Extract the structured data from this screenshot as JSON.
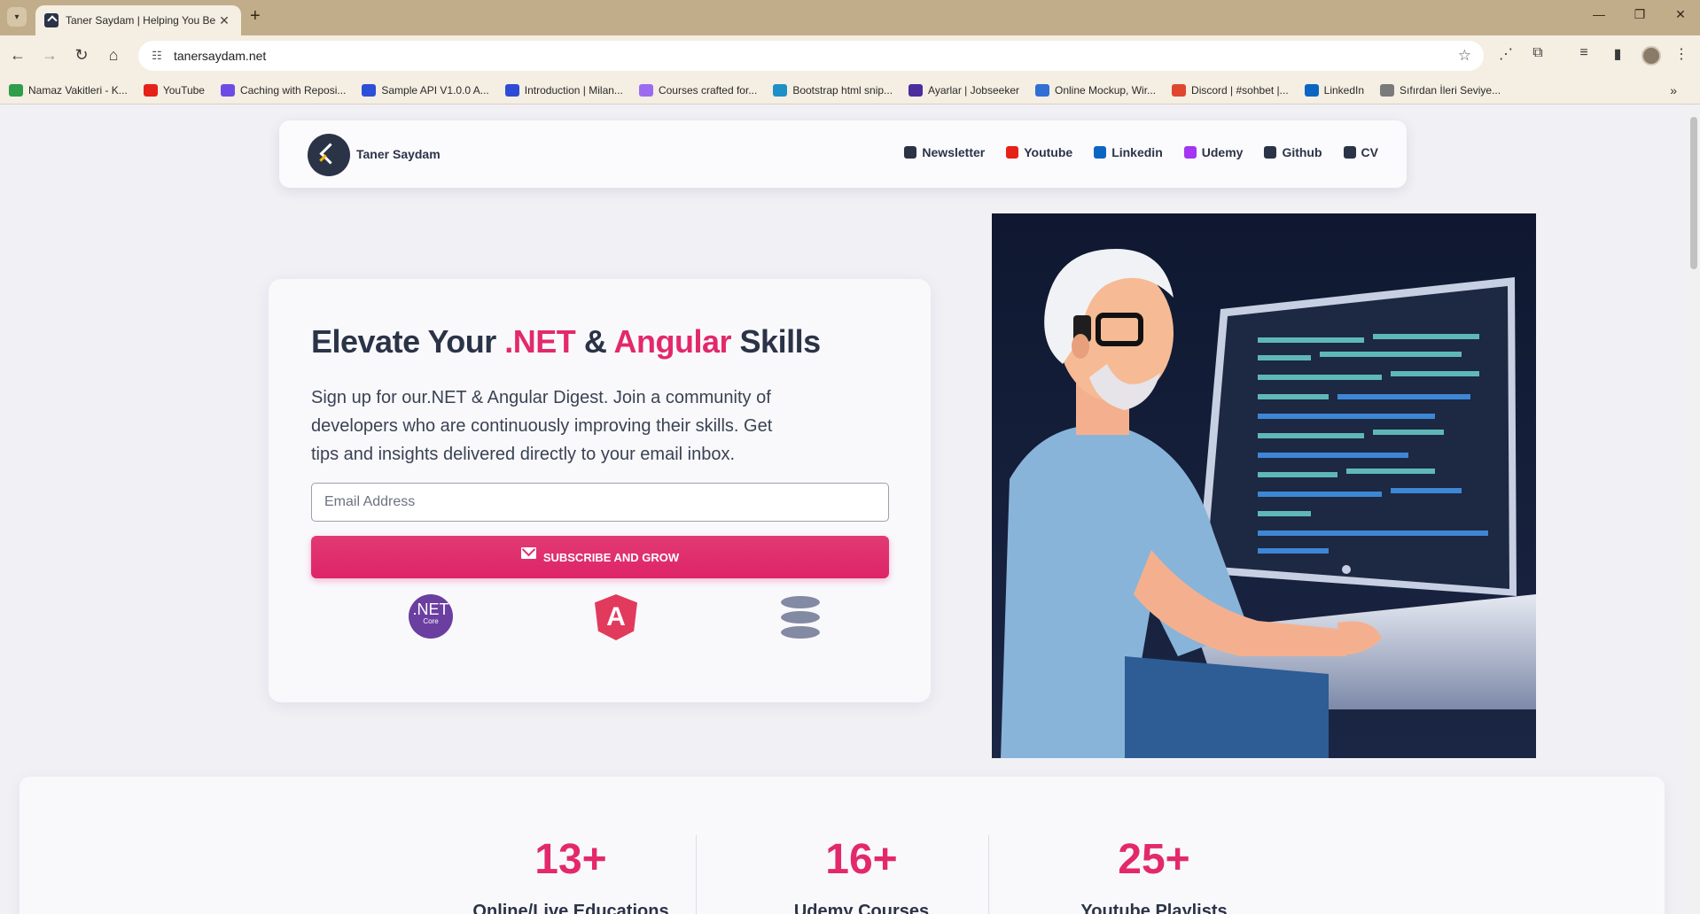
{
  "browser": {
    "tab_title": "Taner Saydam | Helping You Be",
    "url": "tanersaydam.net",
    "bookmarks": [
      {
        "label": "Namaz Vakitleri - K...",
        "color": "#2e9e4a"
      },
      {
        "label": "YouTube",
        "color": "#e62117"
      },
      {
        "label": "Caching with Reposi...",
        "color": "#6b4de6"
      },
      {
        "label": "Sample API V1.0.0 A...",
        "color": "#2b4fd6"
      },
      {
        "label": "Introduction | Milan...",
        "color": "#2e4bd6"
      },
      {
        "label": "Courses crafted for...",
        "color": "#9c6cf0"
      },
      {
        "label": "Bootstrap html snip...",
        "color": "#1e90c8"
      },
      {
        "label": "Ayarlar | Jobseeker",
        "color": "#4b2d9e"
      },
      {
        "label": "Online Mockup, Wir...",
        "color": "#2f6fd6"
      },
      {
        "label": "Discord | #sohbet |...",
        "color": "#e0462f"
      },
      {
        "label": "LinkedIn",
        "color": "#0a66c2"
      },
      {
        "label": "Sıfırdan İleri Seviye...",
        "color": "#7a7a7a"
      }
    ]
  },
  "header": {
    "brand": "Taner Saydam",
    "nav": [
      {
        "label": "Newsletter",
        "icon": "newsletter-icon",
        "color": "#2b3347"
      },
      {
        "label": "Youtube",
        "icon": "youtube-icon",
        "color": "#e62117"
      },
      {
        "label": "Linkedin",
        "icon": "linkedin-icon",
        "color": "#0a66c2"
      },
      {
        "label": "Udemy",
        "icon": "udemy-icon",
        "color": "#a435f0"
      },
      {
        "label": "Github",
        "icon": "github-icon",
        "color": "#2b3347"
      },
      {
        "label": "CV",
        "icon": "cv-icon",
        "color": "#2b3347"
      }
    ]
  },
  "hero": {
    "title_part1": "Elevate Your",
    "title_net": ".NET",
    "title_amp": "&",
    "title_angular": "Angular",
    "title_part2": "Skills",
    "description": "Sign up for our.NET & Angular Digest. Join a community of developers who are continuously improving their skills. Get tips and insights delivered directly to your email inbox.",
    "email_placeholder": "Email Address",
    "subscribe_label": "SUBSCRIBE AND GROW",
    "net_logo_main": ".NET",
    "net_logo_sub": "Core",
    "angular_logo_text": "A"
  },
  "stats": [
    {
      "value": "13+",
      "label": "Online/Live Educations"
    },
    {
      "value": "16+",
      "label": "Udemy Courses"
    },
    {
      "value": "25+",
      "label": "Youtube Playlists"
    }
  ],
  "colors": {
    "accent": "#e3296a",
    "text_dark": "#2b3347",
    "page_bg": "#f1f0f5"
  }
}
